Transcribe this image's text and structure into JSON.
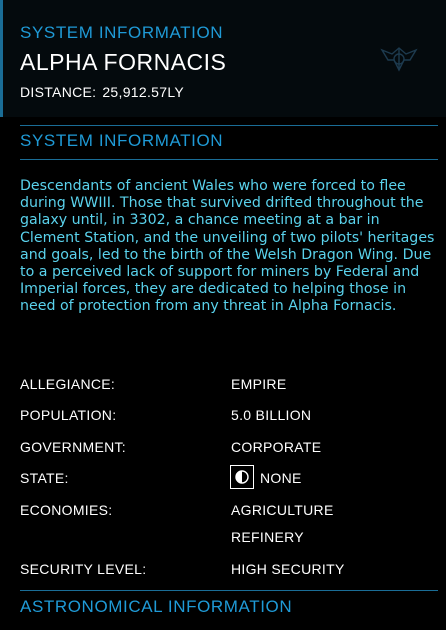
{
  "header": {
    "section_title": "SYSTEM INFORMATION",
    "system_name": "ALPHA FORNACIS",
    "distance_label": "DISTANCE:",
    "distance_value": "25,912.57LY",
    "emblem_icon": "faction-emblem-icon"
  },
  "system_info": {
    "title": "SYSTEM INFORMATION",
    "description": "Descendants of ancient Wales who were forced to flee during WWIII. Those that survived drifted throughout the galaxy until, in 3302, a chance meeting at a bar in Clement Station, and the unveiling of two pilots' heritages and goals, led to the birth of the Welsh Dragon Wing. Due to a perceived lack of support for miners by Federal and Imperial forces, they are dedicated to helping those in need of protection from any threat in Alpha Fornacis.",
    "rows": {
      "allegiance": {
        "label": "ALLEGIANCE:",
        "value": "EMPIRE"
      },
      "population": {
        "label": "POPULATION:",
        "value": "5.0 BILLION"
      },
      "government": {
        "label": "GOVERNMENT:",
        "value": "CORPORATE"
      },
      "state": {
        "label": "STATE:",
        "value": "NONE",
        "icon": "half-circle-icon"
      },
      "economies": {
        "label": "ECONOMIES:",
        "values": [
          "AGRICULTURE",
          "REFINERY"
        ]
      },
      "security": {
        "label": "SECURITY LEVEL:",
        "value": "HIGH SECURITY"
      }
    }
  },
  "astronomical": {
    "title": "ASTRONOMICAL INFORMATION"
  },
  "colors": {
    "accent": "#1f9ad6",
    "description_text": "#5ad2ec",
    "header_background": "#040a0d"
  }
}
